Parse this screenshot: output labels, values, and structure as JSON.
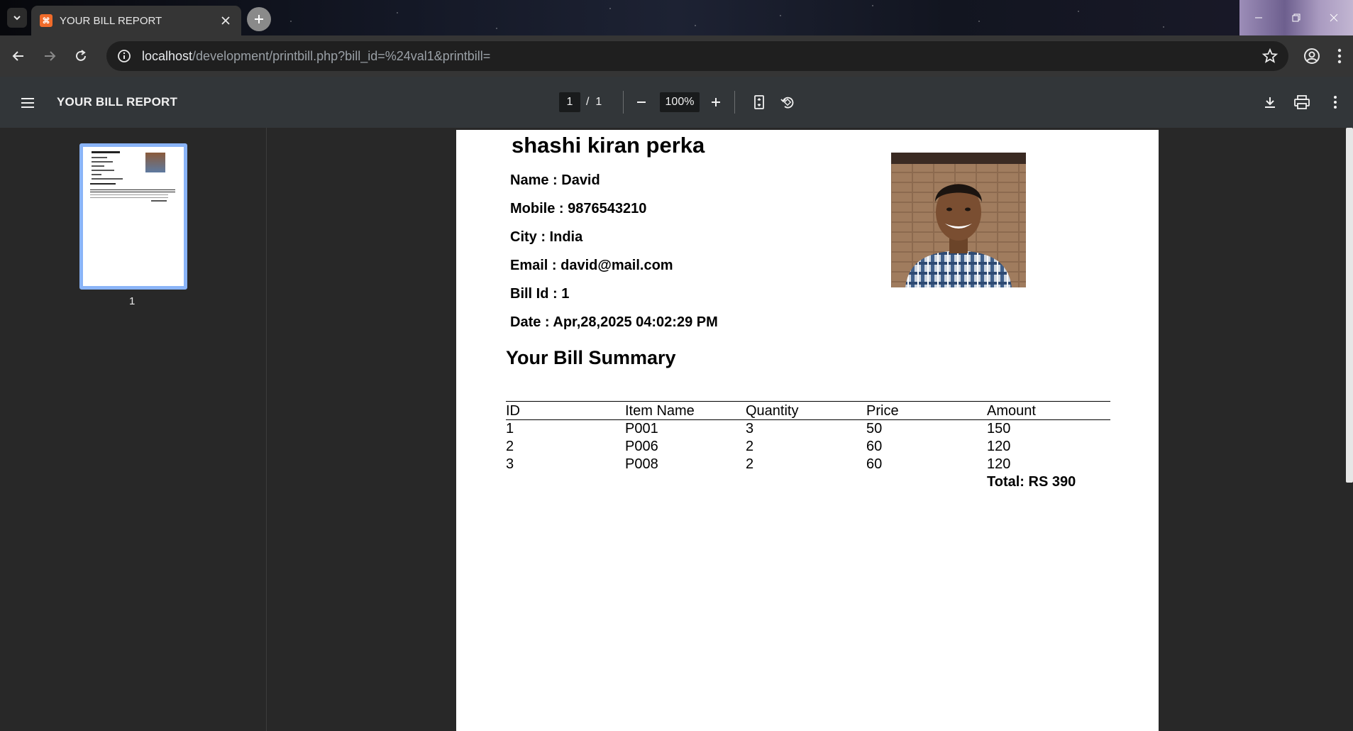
{
  "browser": {
    "tab_title": "YOUR BILL REPORT",
    "favicon_text": "XAMPP",
    "url_host": "localhost",
    "url_path": "/development/printbill.php?bill_id=%24val1&printbill="
  },
  "pdf_viewer": {
    "title": "YOUR BILL REPORT",
    "current_page": "1",
    "page_separator": "/",
    "total_pages": "1",
    "zoom": "100%",
    "thumbnail_label": "1"
  },
  "document": {
    "name_heading": "shashi kiran perka",
    "fields": [
      "Name : David",
      "Mobile : 9876543210",
      "City : India",
      "Email : david@mail.com",
      "Bill Id : 1",
      "Date : Apr,28,2025 04:02:29 PM"
    ],
    "summary_title": "Your Bill Summary",
    "table": {
      "headers": [
        "ID",
        "Item Name",
        "Quantity",
        "Price",
        "Amount"
      ],
      "rows": [
        [
          "1",
          "P001",
          "3",
          "50",
          "150"
        ],
        [
          "2",
          "P006",
          "2",
          "60",
          "120"
        ],
        [
          "3",
          "P008",
          "2",
          "60",
          "120"
        ]
      ],
      "total": "Total: RS 390"
    }
  },
  "colors": {
    "thumbnail_border": "#8ab4f8",
    "favicon": "#f06b2a"
  }
}
